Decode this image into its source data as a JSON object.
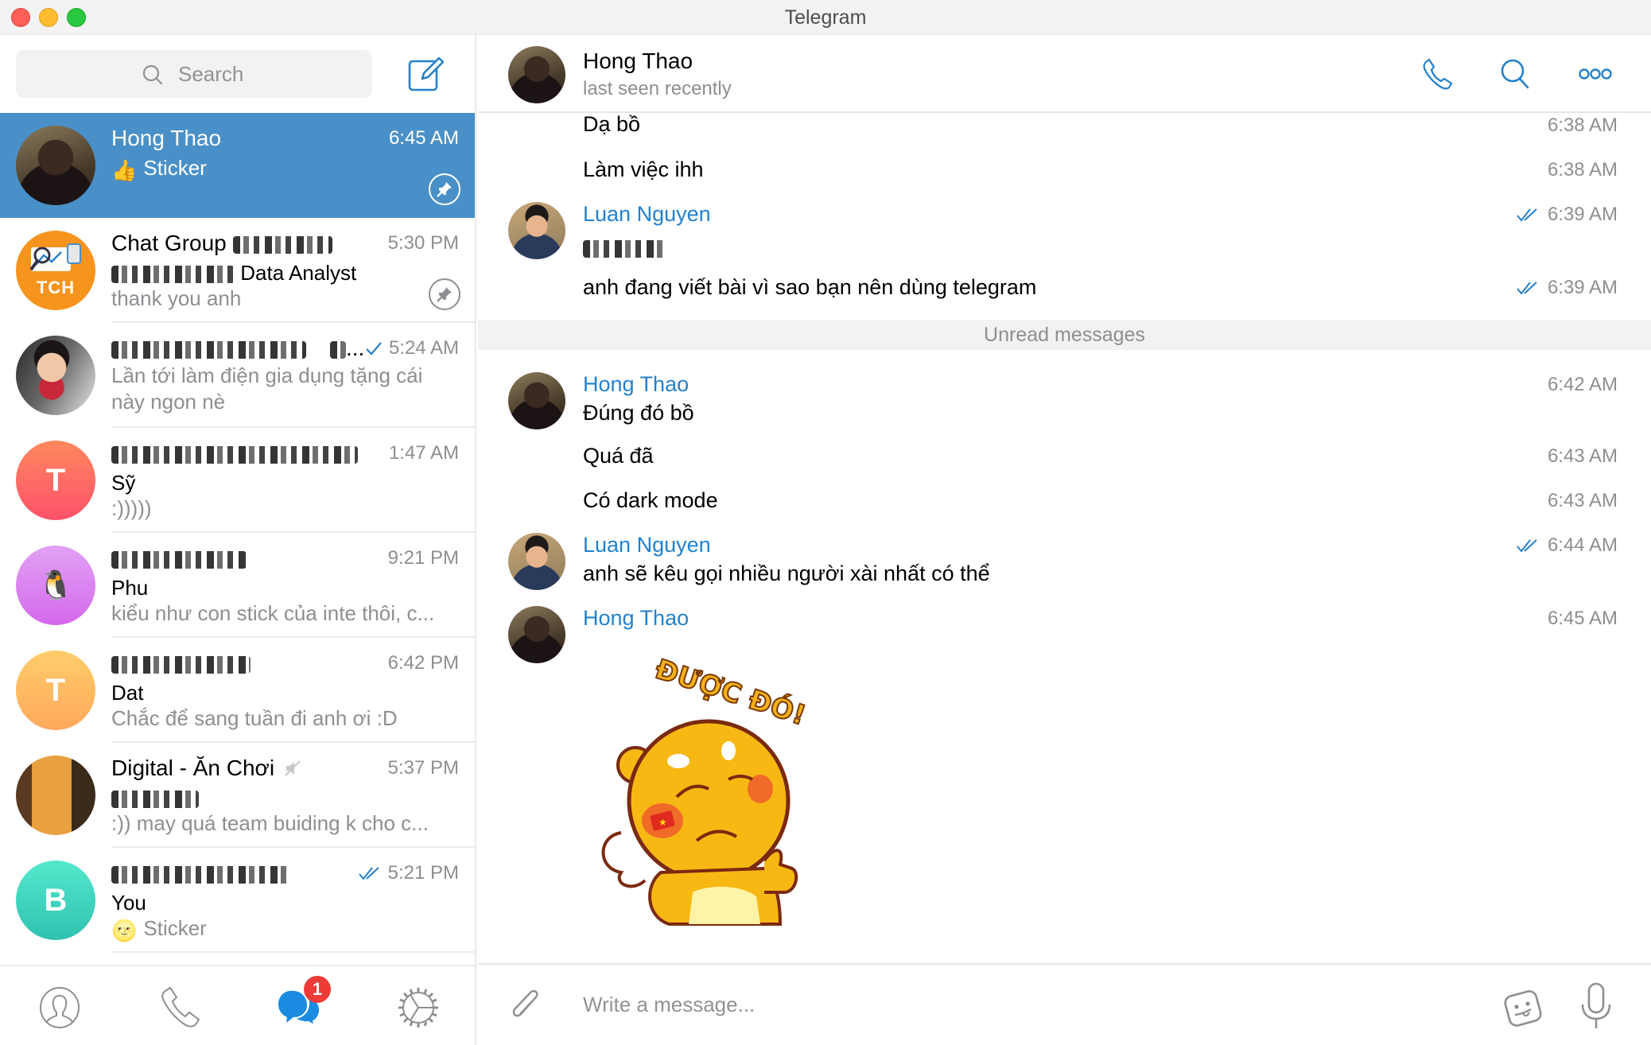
{
  "window": {
    "title": "Telegram"
  },
  "sidebar": {
    "search_placeholder": "Search",
    "chats": [
      {
        "title": "Hong Thao",
        "time": "6:45 AM",
        "preview_emoji": "👍",
        "preview": "Sticker",
        "pinned": true,
        "selected": true
      },
      {
        "title": "Chat Group",
        "title_suffix_redacted": true,
        "time": "5:30 PM",
        "subtitle_suffix": "Data Analyst",
        "avatar_text": "TCH",
        "preview": "thank you anh",
        "pinned": true
      },
      {
        "title_redacted": true,
        "title_suffix": "...",
        "time": "5:24 AM",
        "status": "sent",
        "preview": "Lần tới làm điện gia dụng tặng cái này ngon nè"
      },
      {
        "title_redacted": true,
        "time": "1:47 AM",
        "sender": "Sỹ",
        "preview": ":)))))",
        "avatar_letter": "T"
      },
      {
        "title_redacted": true,
        "time": "9:21 PM",
        "sender": "Phu",
        "preview": "kiểu như con stick của inte thôi, c...",
        "avatar_emoji": "🐧"
      },
      {
        "title_redacted": true,
        "time": "6:42 PM",
        "sender": "Dat",
        "preview": "Chắc để sang tuần đi anh ơi :D",
        "avatar_letter": "T"
      },
      {
        "title": "Digital - Ăn Chơi",
        "muted": true,
        "time": "5:37 PM",
        "sender_redacted": true,
        "preview": ":)) may quá team buiding k cho c..."
      },
      {
        "title_redacted": true,
        "time": "5:21 PM",
        "status": "read",
        "sender": "You",
        "preview_emoji": "🌝",
        "preview": "Sticker",
        "avatar_letter": "B"
      }
    ]
  },
  "bottom_nav": {
    "items": [
      {
        "name": "contacts",
        "icon": "person-icon"
      },
      {
        "name": "calls",
        "icon": "phone-icon"
      },
      {
        "name": "chats",
        "icon": "chat-bubbles-icon",
        "active": true,
        "badge": "1"
      },
      {
        "name": "settings",
        "icon": "gear-icon"
      }
    ]
  },
  "chat": {
    "name": "Hong Thao",
    "status": "last seen recently",
    "unread_divider": "Unread messages",
    "messages": [
      {
        "text": "Dạ bồ",
        "time": "6:38 AM"
      },
      {
        "text": "Làm việc ihh",
        "time": "6:38 AM"
      },
      {
        "sender": "Luan Nguyen",
        "text_redacted": true,
        "time": "6:39 AM",
        "status": "read"
      },
      {
        "text": "anh đang viết bài vì sao bạn nên dùng telegram",
        "time": "6:39 AM",
        "status": "read"
      },
      {
        "sender": "Hong Thao",
        "text": "Đúng đó bồ",
        "time": "6:42 AM"
      },
      {
        "text": "Quá đã",
        "time": "6:43 AM"
      },
      {
        "text": "Có dark mode",
        "time": "6:43 AM"
      },
      {
        "sender": "Luan Nguyen",
        "text": "anh sẽ kêu gọi nhiều người xài nhất có thể",
        "time": "6:44 AM",
        "status": "read"
      },
      {
        "sender": "Hong Thao",
        "time": "6:45 AM",
        "sticker_caption": "ĐƯỢC ĐÓ!"
      }
    ]
  },
  "composer": {
    "placeholder": "Write a message..."
  },
  "colors": {
    "accent": "#2481cc",
    "selected_row": "#4a90c8",
    "badge": "#ef3b36",
    "secondary_text": "#8e8e93"
  }
}
